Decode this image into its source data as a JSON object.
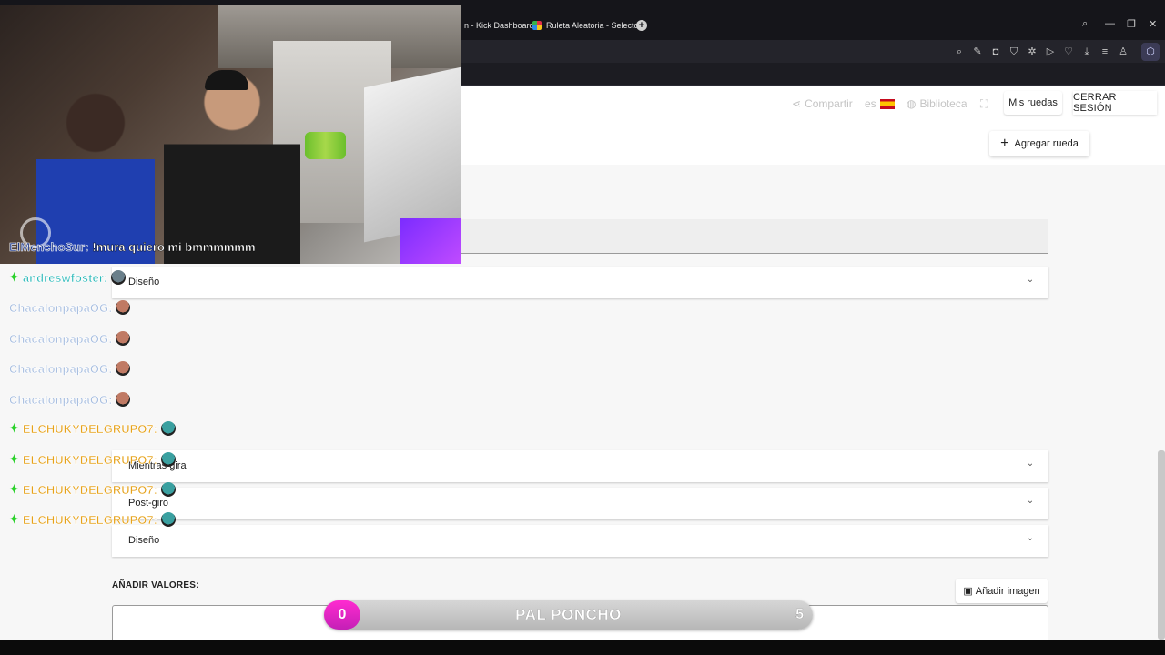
{
  "browser": {
    "tabs": [
      {
        "label": "n - Kick Dashboard",
        "fav_color": "#15151a"
      },
      {
        "label": "Ruleta Aleatoria - Selector",
        "fav_color": "#e0304a"
      }
    ],
    "new_tab_symbol": "+",
    "toolbar_icons": [
      "search-icon",
      "edit-icon",
      "camera-icon",
      "shield-icon",
      "settings-icon",
      "play-icon",
      "heart-icon",
      "download-icon",
      "menu-icon",
      "account-icon",
      "extension-icon"
    ],
    "window_controls": [
      "search-icon",
      "minimize-icon",
      "restore-icon",
      "close-icon"
    ]
  },
  "header": {
    "share_label": "Compartir",
    "lang_label": "es",
    "library_label": "Biblioteca",
    "my_wheels_label": "Mis ruedas",
    "logout_label": "CERRAR SESIÓN",
    "add_wheel_label": "Agregar rueda"
  },
  "accordions": {
    "design_top": "Diseño",
    "while_spinning": "Mientras gira",
    "post_spin": "Post-giro",
    "design_bottom": "Diseño"
  },
  "values_section": {
    "label": "AÑADIR VALORES:",
    "add_image_label": "Añadir imagen"
  },
  "overlay": {
    "cam_caption_name": "ElMenchoSur:",
    "cam_caption_msg": "!mura quiero mi bmmmmmm",
    "chat": [
      {
        "name": "andreswfoster:",
        "color": "#28b8b8",
        "badge": true
      },
      {
        "name": "ChacalonpapaOG:",
        "color": "#a9bfe0",
        "badge": false
      },
      {
        "name": "ChacalonpapaOG:",
        "color": "#a9bfe0",
        "badge": false
      },
      {
        "name": "ChacalonpapaOG:",
        "color": "#a9bfe0",
        "badge": false
      },
      {
        "name": "ChacalonpapaOG:",
        "color": "#a9bfe0",
        "badge": false
      },
      {
        "name": "ELCHUKYDELGRUPO7:",
        "color": "#e6a21a",
        "badge": true
      },
      {
        "name": "ELCHUKYDELGRUPO7:",
        "color": "#e6a21a",
        "badge": true
      },
      {
        "name": "ELCHUKYDELGRUPO7:",
        "color": "#e6a21a",
        "badge": true
      },
      {
        "name": "ELCHUKYDELGRUPO7:",
        "color": "#e6a21a",
        "badge": true
      }
    ],
    "progress": {
      "left_value": "0",
      "title": "PAL PONCHO",
      "right_value": "5",
      "fraction": 0.0,
      "fill_color": "#ff2bd0"
    }
  },
  "colors": {
    "accent_pink": "#ff2bd0",
    "kick_green": "#2ad12a",
    "chrome_dark": "#15151a"
  }
}
